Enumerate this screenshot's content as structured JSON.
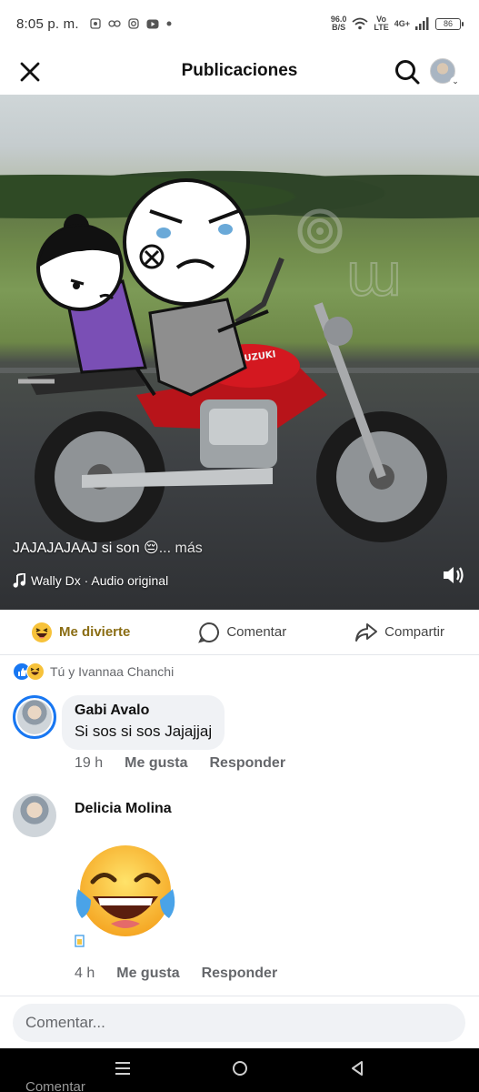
{
  "status_bar": {
    "time": "8:05 p. m.",
    "speed_top": "96.0",
    "speed_bottom": "B/S",
    "net_top": "Vo",
    "net_bottom": "LTE",
    "signal": "4G+",
    "battery": "86"
  },
  "header": {
    "title": "Publicaciones"
  },
  "video": {
    "caption": "JAJAJAJAAJ si son 😔",
    "caption_more": "... más",
    "audio": "Wally Dx · Audio original",
    "motorcycle_brand": "SUZUKI",
    "watermark": "ɯ"
  },
  "actions": {
    "react_label": "Me divierte",
    "comment_label": "Comentar",
    "share_label": "Compartir",
    "react_color": "#8a6d14"
  },
  "reactions": {
    "summary": "Tú y Ivannaa Chanchi"
  },
  "comments": [
    {
      "name": "Gabi Avalo",
      "text": "Si sos si sos Jajajjaj",
      "time": "19 h",
      "like": "Me gusta",
      "reply": "Responder"
    },
    {
      "name": "Delicia Molina",
      "sticker": "laughing-tears-emoji",
      "time": "4 h",
      "like": "Me gusta",
      "reply": "Responder"
    }
  ],
  "composer": {
    "placeholder": "Comentar..."
  },
  "ghost_text": "Comentar",
  "colors": {
    "facebook_blue": "#1877f2",
    "bubble_bg": "#f0f2f5",
    "muted_text": "#65676b"
  }
}
